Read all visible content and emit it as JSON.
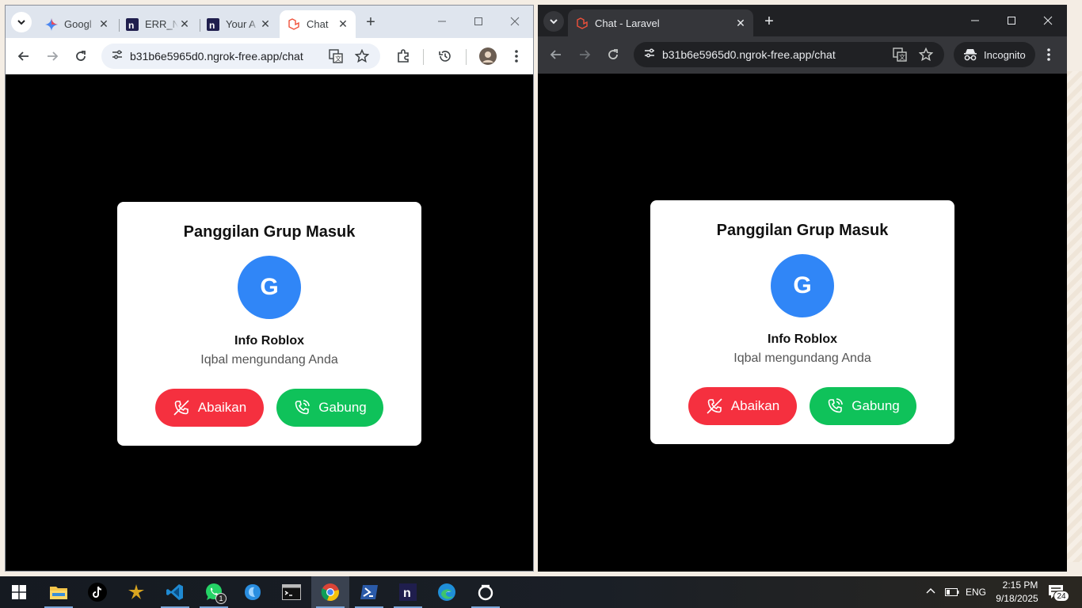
{
  "window_left": {
    "tabs": [
      {
        "title": "Googl",
        "favicon": "gemini-icon"
      },
      {
        "title": "ERR_N",
        "favicon": "ngrok-icon"
      },
      {
        "title": "Your A",
        "favicon": "ngrok-icon"
      },
      {
        "title": "Chat",
        "favicon": "laravel-icon",
        "active": true
      }
    ],
    "url": "b31b6e5965d0.ngrok-free.app/chat",
    "modal": {
      "title": "Panggilan Grup Masuk",
      "avatar_letter": "G",
      "group_name": "Info Roblox",
      "invite_text": "Iqbal mengundang Anda",
      "decline_label": "Abaikan",
      "join_label": "Gabung"
    }
  },
  "window_right": {
    "tabs": [
      {
        "title": "Chat - Laravel",
        "favicon": "laravel-icon",
        "active": true
      }
    ],
    "url": "b31b6e5965d0.ngrok-free.app/chat",
    "incognito_label": "Incognito",
    "modal": {
      "title": "Panggilan Grup Masuk",
      "avatar_letter": "G",
      "group_name": "Info Roblox",
      "invite_text": "Iqbal mengundang Anda",
      "decline_label": "Abaikan",
      "join_label": "Gabung"
    }
  },
  "taskbar": {
    "apps": [
      "start-icon",
      "file-explorer-icon",
      "tiktok-icon",
      "app-icon",
      "vscode-icon",
      "whatsapp-icon",
      "app-icon",
      "terminal-icon",
      "chrome-icon",
      "powershell-icon",
      "ngrok-icon",
      "edge-icon",
      "app-icon"
    ],
    "whatsapp_badge": "1",
    "language": "ENG",
    "time": "2:15 PM",
    "date": "9/18/2025",
    "notification_count": "24"
  },
  "colors": {
    "decline": "#f5303f",
    "join": "#0fc25a",
    "avatar": "#3086f7"
  }
}
